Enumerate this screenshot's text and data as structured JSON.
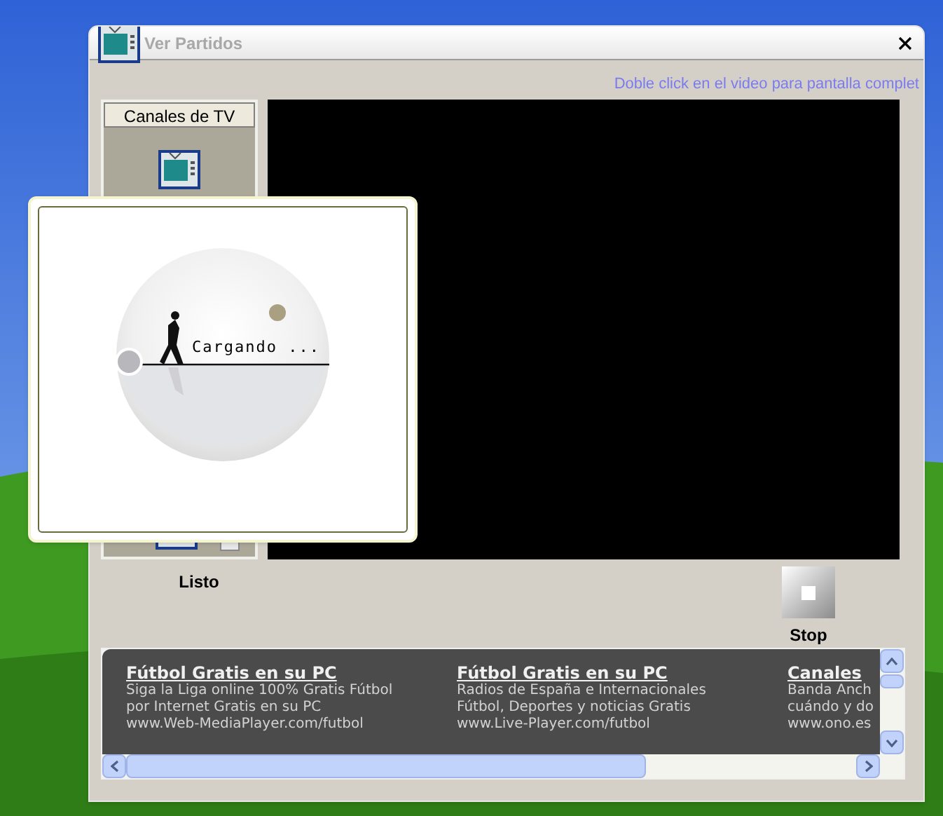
{
  "window": {
    "title": "Ver Partidos",
    "hint": "Doble click en el video para pantalla complet"
  },
  "channels_panel": {
    "header": "Canales de TV"
  },
  "status": "Listo",
  "stop_button": {
    "label": "Stop"
  },
  "loading": {
    "text": "Cargando ..."
  },
  "ads": [
    {
      "title": "Fútbol Gratis en su PC",
      "lines": [
        "Siga la Liga online 100% Gratis Fútbol",
        "por Internet Gratis en su PC",
        "www.Web-MediaPlayer.com/futbol"
      ]
    },
    {
      "title": "Fútbol Gratis en su PC",
      "lines": [
        "Radios de España e Internacionales",
        "Fútbol, Deportes y noticias Gratis",
        "www.Live-Player.com/futbol"
      ]
    },
    {
      "title": "Canales",
      "lines": [
        "Banda Anch",
        "cuándo y do",
        "www.ono.es"
      ]
    }
  ]
}
